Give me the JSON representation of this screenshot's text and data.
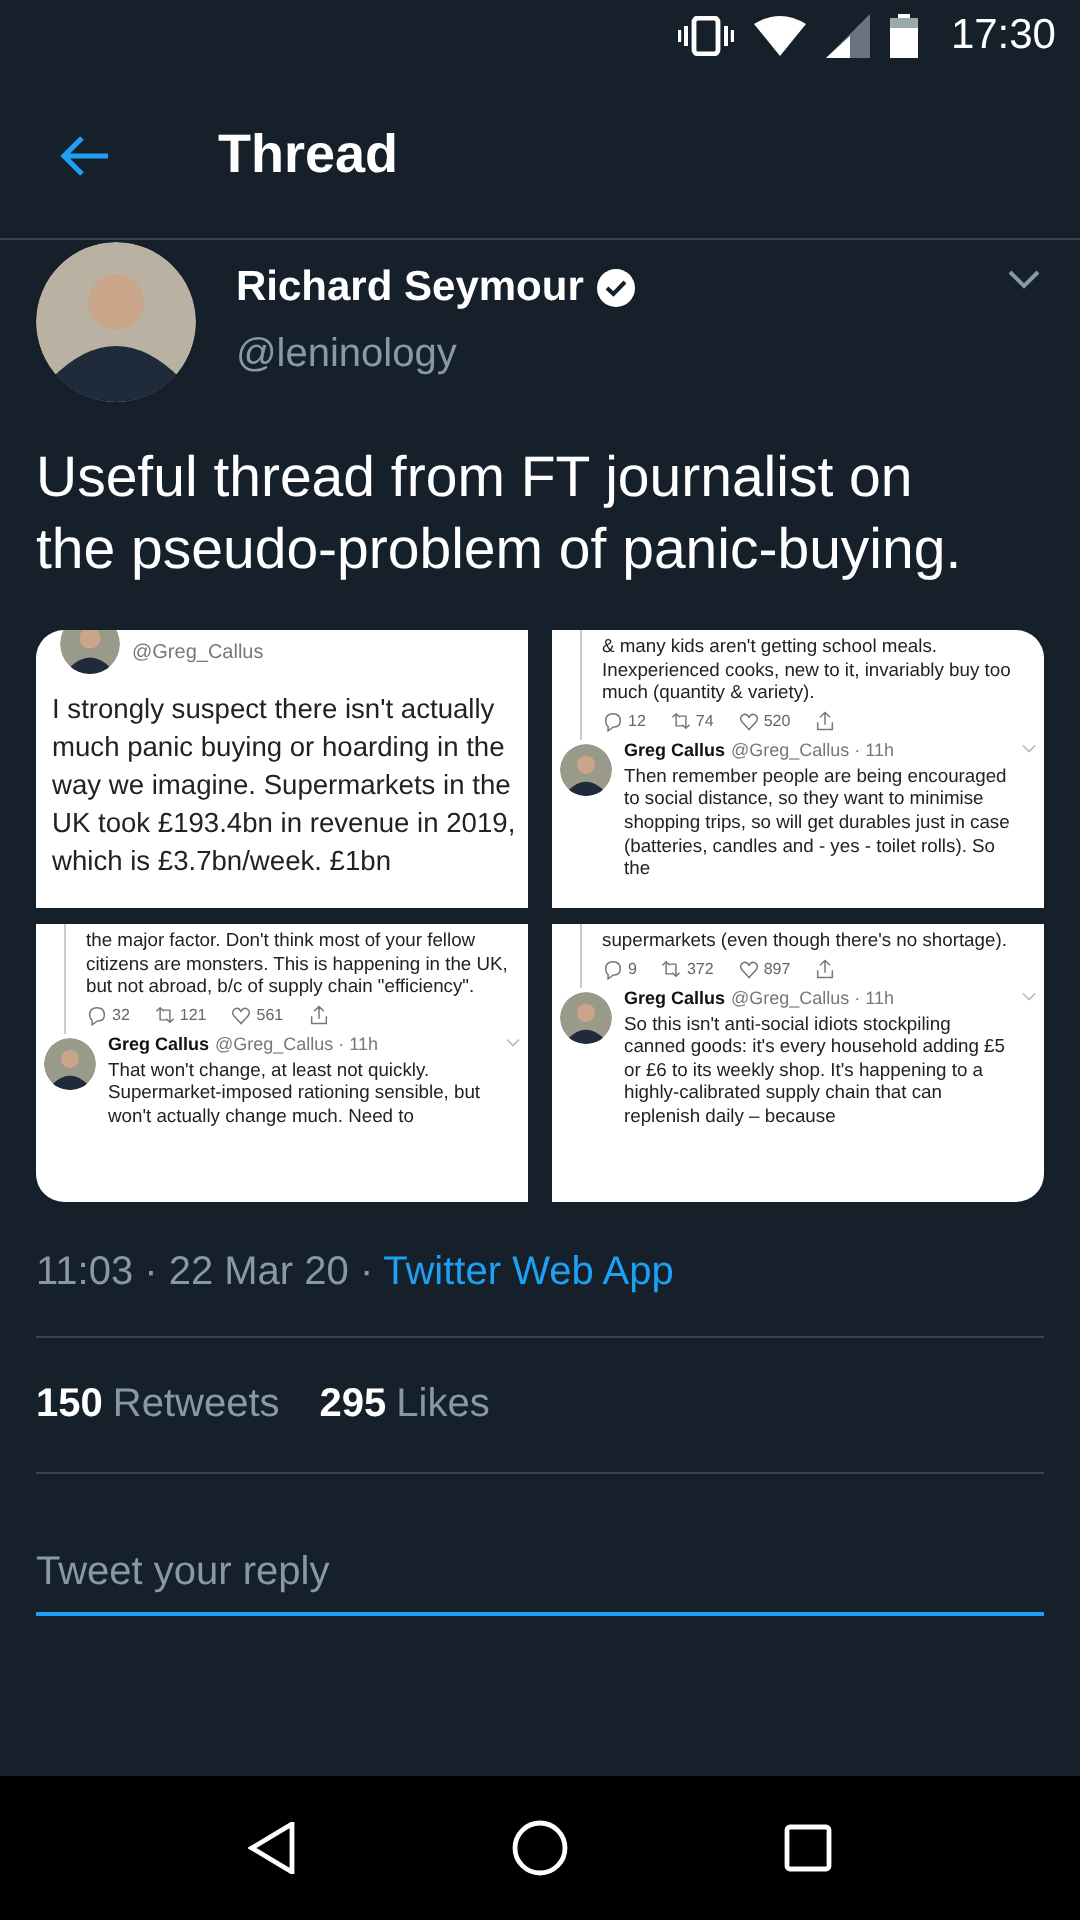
{
  "status_bar": {
    "time": "17:30"
  },
  "header": {
    "title": "Thread"
  },
  "tweet": {
    "author": "Richard Seymour",
    "verified": true,
    "handle": "@leninology",
    "text": "Useful thread from FT journalist on the pseudo-problem of panic-buying.",
    "media": [
      {
        "blocks": [
          {
            "kind": "handle",
            "handle": "@Greg_Callus"
          },
          {
            "kind": "lead",
            "text": "I strongly suspect there isn't actually much panic buying or hoarding in the way we imagine. Supermarkets in the UK took £193.4bn in revenue in 2019, which is £3.7bn/week. £1bn"
          }
        ]
      },
      {
        "blocks": [
          {
            "kind": "text",
            "text": "& many kids aren't getting school meals. Inexperienced cooks, new to it, invariably buy too much (quantity & variety)."
          },
          {
            "kind": "actions",
            "counts": [
              "12",
              "74",
              "520"
            ]
          },
          {
            "kind": "reply",
            "name": "Greg Callus",
            "handle": "@Greg_Callus · 11h",
            "text": "Then remember people are being encouraged to social distance, so they want to minimise shopping trips, so will get durables just in case (batteries, candles and - yes - toilet rolls). So the"
          }
        ]
      },
      {
        "blocks": [
          {
            "kind": "text",
            "text": "the major factor. Don't think most of your fellow citizens are monsters. This is happening in the UK,  but not abroad, b/c of supply chain \"efficiency\"."
          },
          {
            "kind": "actions",
            "counts": [
              "32",
              "121",
              "561"
            ]
          },
          {
            "kind": "reply",
            "name": "Greg Callus",
            "handle": "@Greg_Callus · 11h",
            "text": "That won't change, at least not quickly. Supermarket-imposed rationing sensible, but won't actually change much. Need to"
          }
        ]
      },
      {
        "blocks": [
          {
            "kind": "text",
            "text": "supermarkets (even though there's no shortage)."
          },
          {
            "kind": "actions",
            "counts": [
              "9",
              "372",
              "897"
            ]
          },
          {
            "kind": "reply",
            "name": "Greg Callus",
            "handle": "@Greg_Callus · 11h",
            "text": "So this isn't anti-social idiots stockpiling canned goods: it's every household adding £5 or £6 to its weekly shop. It's happening to a highly-calibrated supply chain that can replenish daily – because"
          }
        ]
      }
    ],
    "timestamp": "11:03 · 22 Mar 20 ·",
    "source": "Twitter Web App"
  },
  "stats": [
    {
      "count": "150",
      "label": "Retweets"
    },
    {
      "count": "295",
      "label": "Likes"
    }
  ],
  "reply_field": {
    "placeholder": "Tweet your reply"
  }
}
